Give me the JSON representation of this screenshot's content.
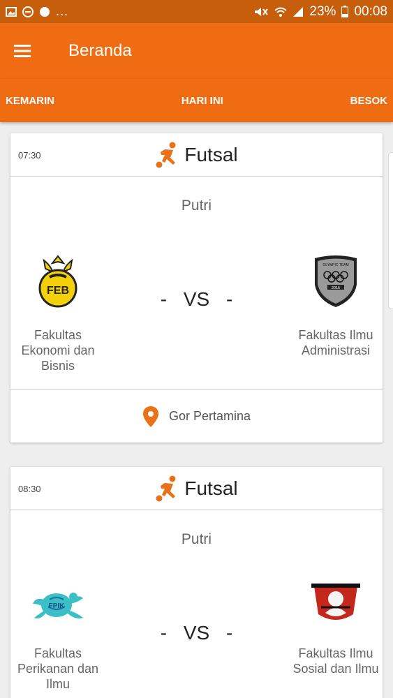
{
  "status_bar": {
    "battery": "23%",
    "time": "00:08",
    "dots": "..."
  },
  "app_bar": {
    "title": "Beranda",
    "menu_icon": "hamburger-menu-icon"
  },
  "tabs": [
    {
      "label": "KEMARIN"
    },
    {
      "label": "HARI INI"
    },
    {
      "label": "BESOK"
    }
  ],
  "matches": [
    {
      "time": "07:30",
      "sport": "Futsal",
      "category": "Putri",
      "home": "Fakultas Ekonomi dan Bisnis",
      "away": "Fakultas Ilmu Administrasi",
      "vs": "- VS -",
      "venue": "Gor Pertamina",
      "home_logo_text": "FEB",
      "away_logo_text": "OLYMPIC TEAM",
      "away_logo_year": "2016"
    },
    {
      "time": "08:30",
      "sport": "Futsal",
      "category": "Putri",
      "home": "Fakultas Perikanan dan Ilmu",
      "away": "Fakultas Ilmu Sosial dan Ilmu",
      "vs": "- VS -",
      "home_logo_text": "FPIK"
    }
  ],
  "colors": {
    "primary": "#ef6c13",
    "status_bar": "#c75e0c",
    "accent_icon": "#e8711a"
  }
}
